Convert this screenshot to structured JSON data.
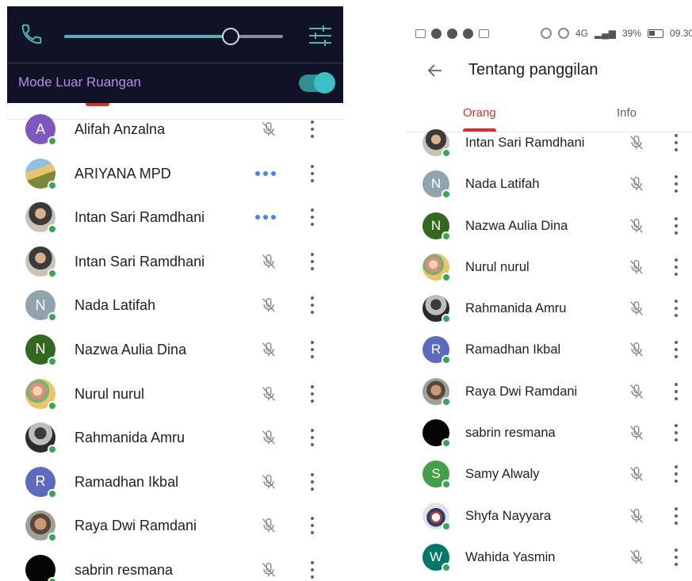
{
  "left_overlay": {
    "outdoor_mode_label": "Mode Luar Ruangan",
    "volume_level": 0.76,
    "outdoor_mode_on": true,
    "icons": [
      "phone-icon",
      "equalizer-icon"
    ],
    "accent_color": "#4fb3b5"
  },
  "left_participants": [
    {
      "name": "Alifah Anzalna",
      "initial": "A",
      "avatar_color": "#7e57c2",
      "status": "muted"
    },
    {
      "name": "ARIYANA MPD",
      "initial": "",
      "avatar_photo": "beach",
      "status": "speaking"
    },
    {
      "name": "Intan Sari Ramdhani",
      "initial": "",
      "avatar_photo": "hijab",
      "status": "speaking"
    },
    {
      "name": "Intan Sari Ramdhani",
      "initial": "",
      "avatar_photo": "hijab",
      "status": "muted"
    },
    {
      "name": "Nada Latifah",
      "initial": "N",
      "avatar_color": "#90a4ae",
      "status": "muted"
    },
    {
      "name": "Nazwa Aulia Dina",
      "initial": "N",
      "avatar_color": "#33691e",
      "status": "muted"
    },
    {
      "name": "Nurul nurul",
      "initial": "",
      "avatar_photo": "floral",
      "status": "muted"
    },
    {
      "name": "Rahmanida Amru",
      "initial": "",
      "avatar_photo": "person",
      "status": "muted"
    },
    {
      "name": "Ramadhan Ikbal",
      "initial": "R",
      "avatar_color": "#5c6bc0",
      "status": "muted"
    },
    {
      "name": "Raya Dwi Ramdani",
      "initial": "",
      "avatar_photo": "raya",
      "status": "muted"
    },
    {
      "name": "sabrin resmana",
      "initial": "",
      "avatar_photo": "black",
      "status": "muted"
    }
  ],
  "right_status_bar": {
    "signal": "4G",
    "battery": "39%",
    "time": "09.30"
  },
  "right_header": {
    "title": "Tentang panggilan",
    "tabs": [
      "Orang",
      "Info"
    ],
    "active_tab": "Orang",
    "accent_color": "#d93025"
  },
  "right_participants": [
    {
      "name": "Intan Sari Ramdhani",
      "initial": "",
      "avatar_photo": "hijab"
    },
    {
      "name": "Nada Latifah",
      "initial": "N",
      "avatar_color": "#90a4ae"
    },
    {
      "name": "Nazwa Aulia Dina",
      "initial": "N",
      "avatar_color": "#33691e"
    },
    {
      "name": "Nurul nurul",
      "initial": "",
      "avatar_photo": "floral"
    },
    {
      "name": "Rahmanida Amru",
      "initial": "",
      "avatar_photo": "person"
    },
    {
      "name": "Ramadhan Ikbal",
      "initial": "R",
      "avatar_color": "#5c6bc0"
    },
    {
      "name": "Raya Dwi Ramdani",
      "initial": "",
      "avatar_photo": "raya"
    },
    {
      "name": "sabrin resmana",
      "initial": "",
      "avatar_photo": "black"
    },
    {
      "name": "Samy Alwaly",
      "initial": "S",
      "avatar_color": "#43a047"
    },
    {
      "name": "Shyfa Nayyara",
      "initial": "",
      "avatar_photo": "mask"
    },
    {
      "name": "Wahida Yasmin",
      "initial": "W",
      "avatar_color": "#00796b"
    }
  ]
}
